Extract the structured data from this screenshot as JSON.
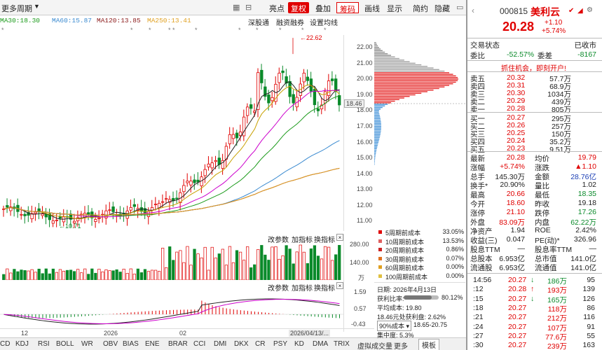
{
  "toolbar": {
    "left_label": "更多周期",
    "items": [
      "亮点",
      "复权",
      "叠加",
      "筹码",
      "画线",
      "显示",
      "简约",
      "隐藏"
    ],
    "active_item": "复权",
    "highlighted_item": "筹码"
  },
  "ma": {
    "ma30": "MA30:18.30",
    "ma60": "MA60:15.87",
    "ma120": "MA120:13.85",
    "ma250": "MA250:13.41"
  },
  "chart_links": [
    "深股通",
    "融资融券",
    "设置均线"
  ],
  "colors": {
    "up": "#e00000",
    "down": "#0a8a2a",
    "ma5": "#222222",
    "ma10": "#c8a000",
    "ma20": "#cc00cc",
    "ma30": "#1a9a1a",
    "ma60": "#3a8ad0",
    "ma120": "#8b1a1a",
    "ma250": "#e0a020"
  },
  "chart_data": {
    "type": "candlestick",
    "y_ticks": [
      "22.00",
      "21.00",
      "20.00",
      "19.00",
      "18.00",
      "17.00",
      "16.00",
      "15.00",
      "14.00",
      "13.00",
      "12.00",
      "11.00"
    ],
    "ylim": [
      10.4,
      22.8
    ],
    "current_price_label": "18.46",
    "high_marker": "22.62",
    "low_marker": "10.71",
    "x_labels": [
      "12",
      "2026",
      "02",
      "2026/04/13/..."
    ]
  },
  "volume": {
    "header": [
      "改参数",
      "加指标",
      "换指标"
    ],
    "ticks": [
      "280.00",
      "140.00",
      "万"
    ]
  },
  "macd": {
    "header": [
      "改参数",
      "加指标",
      "换指标"
    ],
    "ticks": [
      "1.59",
      "0.57",
      "-0.43"
    ]
  },
  "cost_legend": [
    {
      "name": "5周期前成本",
      "value": "33.05%",
      "color": "#e00000"
    },
    {
      "name": "10周期前成本",
      "value": "13.53%",
      "color": "#e06060"
    },
    {
      "name": "20周期前成本",
      "value": "0.86%",
      "color": "#cc2222"
    },
    {
      "name": "30周期前成本",
      "value": "0.07%",
      "color": "#e07020"
    },
    {
      "name": "60周期前成本",
      "value": "0.00%",
      "color": "#e0a020"
    },
    {
      "name": "100周期前成本",
      "value": "0.00%",
      "color": "#e0c040"
    }
  ],
  "cost_info": {
    "date": "日期: 2026年4月13日",
    "win_label": "获利比率:",
    "win_value": "80.12%",
    "avg_cost": "平均成本: 19.80",
    "price_ratio": "18.46元处获利盘: 2.62%",
    "cost_select": "90%成本",
    "range": "18.65-20.75",
    "concentration": "集中度: 5.3%"
  },
  "bottom_tabs": [
    "CD",
    "KDJ",
    "RSI",
    "BOLL",
    "WR",
    "OBV",
    "BIAS",
    "ENE",
    "BRAR",
    "CCI",
    "DMI",
    "DKX",
    "CR",
    "PSY",
    "KD",
    "DMA",
    "TRIX",
    "虚拟成交量",
    "更多",
    "模板"
  ],
  "stock": {
    "code": "000815",
    "name": "美利云",
    "price": "20.28",
    "change": "+1.10",
    "change_pct": "+5.74%",
    "trade_status_label": "交易状态",
    "trade_status": "已收市",
    "wei_bi_label": "委比",
    "wei_bi": "-52.57%",
    "wei_cha_label": "委差",
    "wei_cha": "-8167",
    "promo": "抓住机会，即刻开户!"
  },
  "asks": [
    {
      "label": "卖五",
      "price": "20.32",
      "vol": "57.7万"
    },
    {
      "label": "卖四",
      "price": "20.31",
      "vol": "68.9万"
    },
    {
      "label": "卖三",
      "price": "20.30",
      "vol": "1034万"
    },
    {
      "label": "卖二",
      "price": "20.29",
      "vol": "439万"
    },
    {
      "label": "卖一",
      "price": "20.28",
      "vol": "805万"
    }
  ],
  "bids": [
    {
      "label": "买一",
      "price": "20.27",
      "vol": "295万"
    },
    {
      "label": "买二",
      "price": "20.26",
      "vol": "257万"
    },
    {
      "label": "买三",
      "price": "20.25",
      "vol": "150万"
    },
    {
      "label": "买四",
      "price": "20.24",
      "vol": "35.2万"
    },
    {
      "label": "买五",
      "price": "20.23",
      "vol": "9.51万"
    }
  ],
  "quotes": [
    [
      "最新",
      "20.28",
      "均价",
      "19.79"
    ],
    [
      "涨幅",
      "+5.74%",
      "涨跌",
      "▲1.10"
    ],
    [
      "总手",
      "145.30万",
      "金额",
      "28.76亿"
    ],
    [
      "换手*",
      "20.90%",
      "量比",
      "1.02"
    ],
    [
      "最高",
      "20.66",
      "最低",
      "18.35"
    ],
    [
      "今开",
      "18.60",
      "昨收",
      "19.18"
    ],
    [
      "涨停",
      "21.10",
      "跌停",
      "17.26"
    ],
    [
      "外盘",
      "83.09万",
      "内盘",
      "62.22万"
    ],
    [
      "净资产",
      "1.94",
      "ROE",
      "2.42%"
    ],
    [
      "收益(三)",
      "0.047",
      "PE(动)*",
      "326.96"
    ],
    [
      "股息TTM",
      "—",
      "股息率TTM",
      "—"
    ],
    [
      "总股本",
      "6.953亿",
      "总市值",
      "141.0亿"
    ],
    [
      "流通股",
      "6.953亿",
      "流通值",
      "141.0亿"
    ]
  ],
  "ticks": [
    {
      "time": "14:56",
      "price": "20.27",
      "arrow": "↓",
      "vol": "186万",
      "n": "95"
    },
    {
      "time": ":12",
      "price": "20.28",
      "arrow": "↑",
      "vol": "193万",
      "n": "139"
    },
    {
      "time": ":15",
      "price": "20.27",
      "arrow": "↓",
      "vol": "165万",
      "n": "126"
    },
    {
      "time": ":18",
      "price": "20.27",
      "arrow": "",
      "vol": "118万",
      "n": "86"
    },
    {
      "time": ":21",
      "price": "20.27",
      "arrow": "",
      "vol": "212万",
      "n": "116"
    },
    {
      "time": ":24",
      "price": "20.27",
      "arrow": "",
      "vol": "107万",
      "n": "91"
    },
    {
      "time": ":27",
      "price": "20.27",
      "arrow": "",
      "vol": "77.6万",
      "n": "55"
    },
    {
      "time": ":30",
      "price": "20.27",
      "arrow": "",
      "vol": "239万",
      "n": "163"
    }
  ]
}
